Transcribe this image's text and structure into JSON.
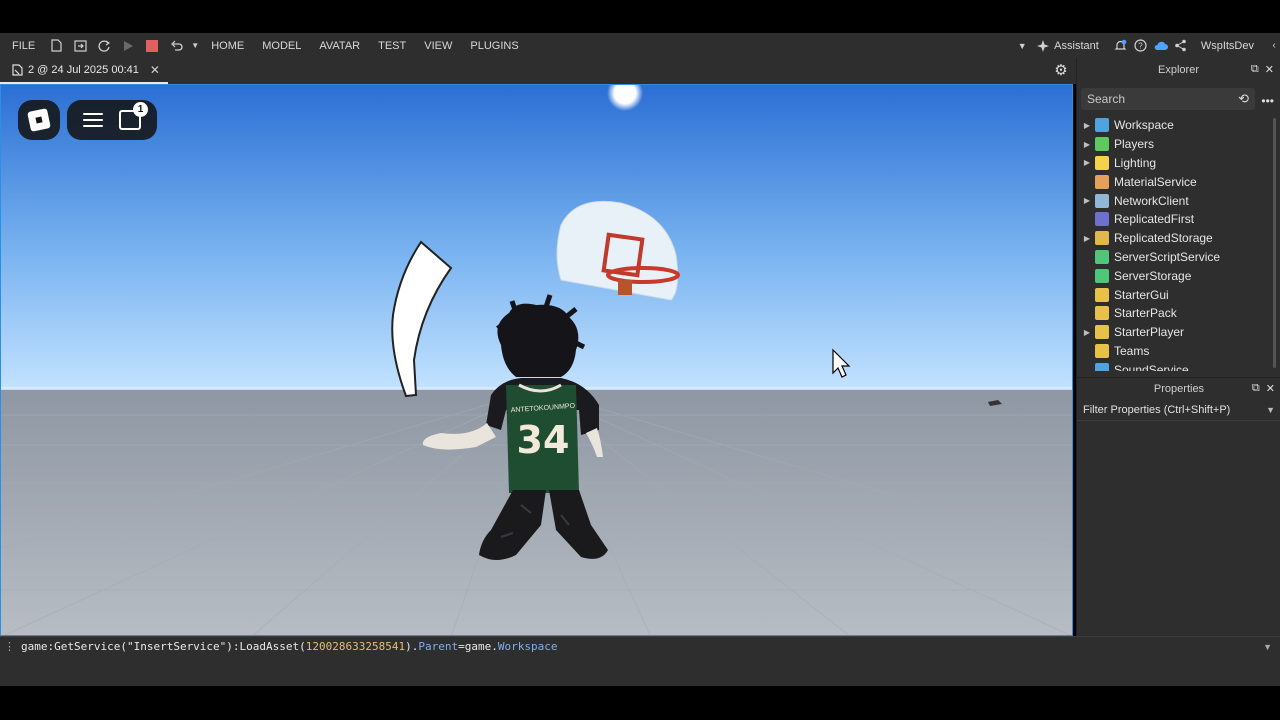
{
  "menubar": {
    "file": "FILE",
    "tabs": [
      "HOME",
      "MODEL",
      "AVATAR",
      "TEST",
      "VIEW",
      "PLUGINS"
    ],
    "assistant": "Assistant",
    "user": "WspItsDev"
  },
  "doc_tab": {
    "title": "2 @ 24 Jul 2025 00:41",
    "close": "✕"
  },
  "viewport": {
    "chat_badge": "1",
    "jersey_name": "ANTETOKOUNMPO",
    "jersey_number": "34"
  },
  "explorer": {
    "title": "Explorer",
    "search_placeholder": "Search",
    "items": [
      {
        "label": "Workspace",
        "expandable": true,
        "color": "#4fa3e0"
      },
      {
        "label": "Players",
        "expandable": true,
        "color": "#5fc95f"
      },
      {
        "label": "Lighting",
        "expandable": true,
        "color": "#f4d34a"
      },
      {
        "label": "MaterialService",
        "expandable": false,
        "color": "#e5a05a"
      },
      {
        "label": "NetworkClient",
        "expandable": true,
        "color": "#8fb8d8"
      },
      {
        "label": "ReplicatedFirst",
        "expandable": false,
        "color": "#6f6fd0"
      },
      {
        "label": "ReplicatedStorage",
        "expandable": true,
        "color": "#e0b84c"
      },
      {
        "label": "ServerScriptService",
        "expandable": false,
        "color": "#4fc77a"
      },
      {
        "label": "ServerStorage",
        "expandable": false,
        "color": "#4fc77a"
      },
      {
        "label": "StarterGui",
        "expandable": false,
        "color": "#e8c14a"
      },
      {
        "label": "StarterPack",
        "expandable": false,
        "color": "#e8c14a"
      },
      {
        "label": "StarterPlayer",
        "expandable": true,
        "color": "#e8c14a"
      },
      {
        "label": "Teams",
        "expandable": false,
        "color": "#e8c14a"
      },
      {
        "label": "SoundService",
        "expandable": false,
        "color": "#4fa3e0"
      }
    ]
  },
  "properties": {
    "title": "Properties",
    "filter_placeholder": "Filter Properties (Ctrl+Shift+P)"
  },
  "command_bar": {
    "part1": "game:GetService(\"InsertService\"):LoadAsset(",
    "asset_id": "120028633258541",
    "part2": ").",
    "parent_kw": "Parent",
    "part3": "=game.",
    "workspace_kw": "Workspace"
  },
  "colors": {
    "accent": "#2b8fe6",
    "panel_bg": "#2e2e2e",
    "jersey_green": "#1e4d32",
    "rim_red": "#c93a2a"
  }
}
